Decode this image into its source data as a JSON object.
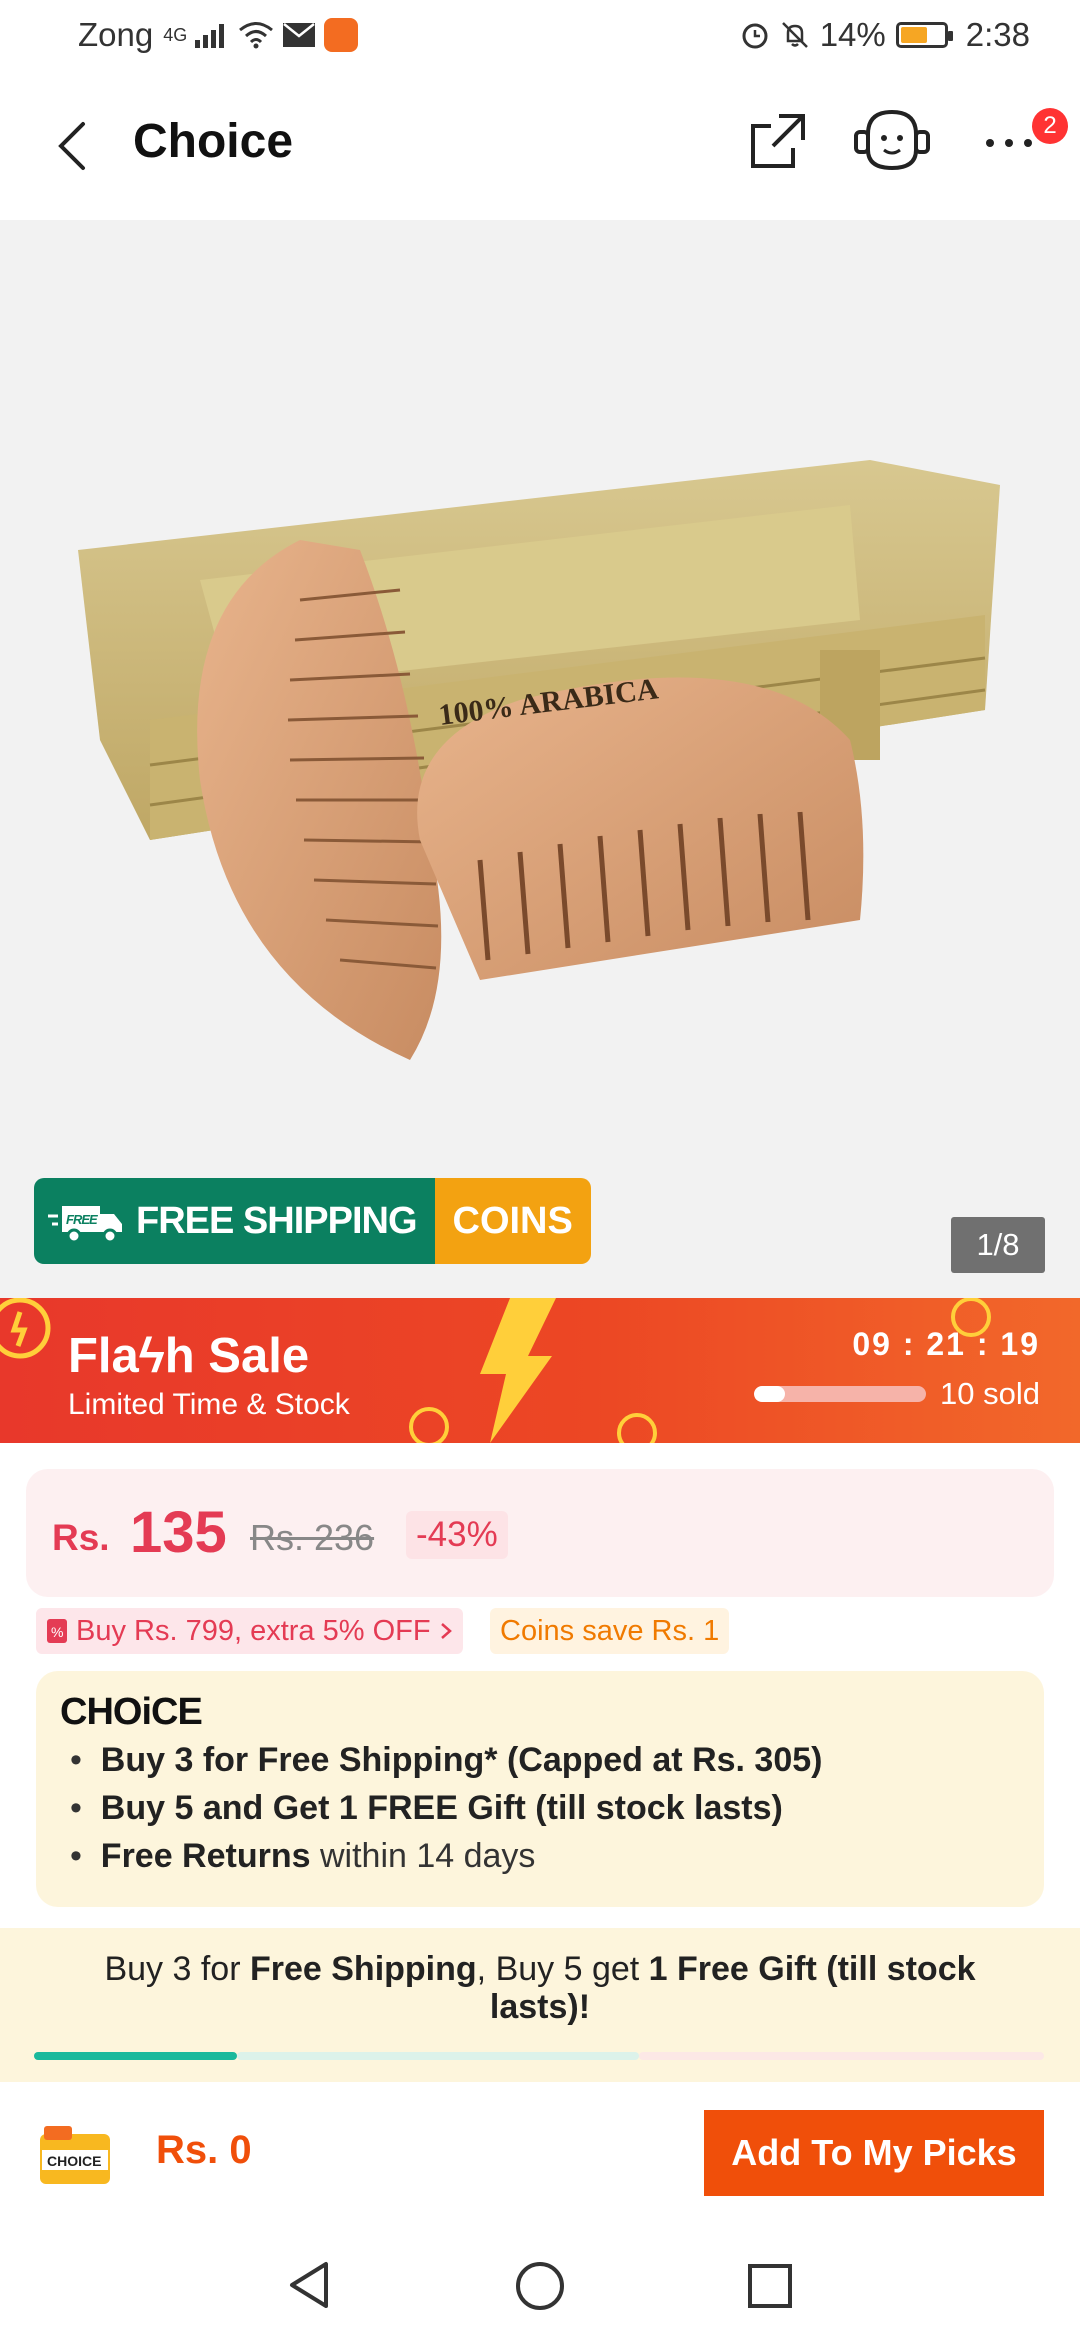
{
  "status_bar": {
    "carrier": "Zong",
    "network": "4G",
    "battery": "14%",
    "time": "2:38"
  },
  "header": {
    "title": "Choice",
    "more_badge": "2"
  },
  "gallery": {
    "image_text": "100% ARABICA",
    "counter": "1/8",
    "free_tag": "FREE",
    "free_shipping": "FREE SHIPPING",
    "coins": "COINS"
  },
  "flash_sale": {
    "title": "Flaϟ",
    "title_end": "h Sale",
    "subtitle": "Limited Time & Stock",
    "timer": "09 : 21 : 19",
    "sold": "10 sold",
    "sold_progress": 0.18
  },
  "price": {
    "currency": "Rs.",
    "amount": "135",
    "original": "Rs. 236",
    "discount": "-43%"
  },
  "promos": {
    "store_offer": "Buy Rs. 799, extra 5% OFF",
    "coins_save": "Coins save Rs. 1"
  },
  "choice": {
    "logo": "CHOiCE",
    "line1_bold": "Buy 3 for  Free Shipping* (Capped at Rs. 305)",
    "line2_bold": "Buy 5 and Get 1 FREE Gift (till stock lasts)",
    "line3_bold": "Free Returns",
    "line3_rest": " within 14 days"
  },
  "strip": {
    "p1": "Buy 3 for ",
    "b1": "Free Shipping",
    "p2": ", Buy 5 get ",
    "b2": "1 Free Gift (till stock lasts)!"
  },
  "action_bar": {
    "cart_label": "CHOICE",
    "cart_amount": "Rs. 0",
    "add_button": "Add To My Picks"
  },
  "colors": {
    "accent": "#f04f0a",
    "price": "#e43b54",
    "green": "#0b8060",
    "coins": "#f3a211"
  }
}
